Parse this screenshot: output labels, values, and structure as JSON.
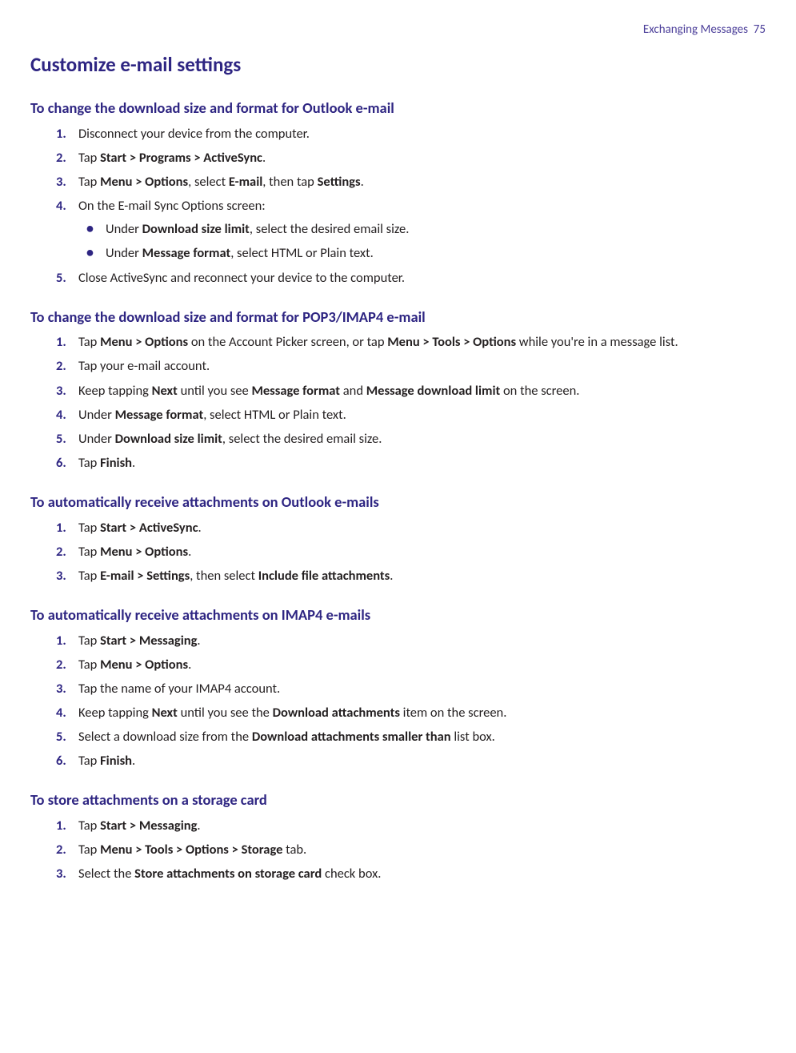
{
  "header": {
    "chapter": "Exchanging Messages",
    "page": "75"
  },
  "title": "Customize e-mail settings",
  "sections": [
    {
      "heading": "To change the download size and format for Outlook e-mail",
      "steps": [
        {
          "html": "Disconnect your device from the computer."
        },
        {
          "html": "Tap <b>Start > Programs > ActiveSync</b>."
        },
        {
          "html": "Tap <b>Menu > Options</b>, select <b>E-mail</b>, then tap <b>Settings</b>."
        },
        {
          "html": "On the E-mail Sync Options screen:",
          "bullets": [
            "Under <b>Download size limit</b>, select the desired email size.",
            "Under <b>Message format</b>, select HTML or Plain text."
          ]
        },
        {
          "html": "Close ActiveSync and reconnect your device to the computer."
        }
      ]
    },
    {
      "heading": "To change the download size and format for POP3/IMAP4 e-mail",
      "steps": [
        {
          "html": "Tap <b>Menu > Options</b> on the Account Picker screen, or tap <b>Menu > Tools > Options</b> while you're in a message list."
        },
        {
          "html": "Tap your e-mail account."
        },
        {
          "html": "Keep tapping <b>Next</b> until you see <b>Message format</b> and <b>Message download limit</b> on the screen."
        },
        {
          "html": "Under <b>Message format</b>, select HTML or Plain text."
        },
        {
          "html": "Under <b>Download size limit</b>, select the desired email size."
        },
        {
          "html": "Tap <b>Finish</b>."
        }
      ]
    },
    {
      "heading": "To automatically receive attachments on Outlook e-mails",
      "steps": [
        {
          "html": "Tap <b>Start > ActiveSync</b>."
        },
        {
          "html": "Tap <b>Menu > Options</b>."
        },
        {
          "html": "Tap <b>E-mail > Settings</b>, then select <b>Include file attachments</b>."
        }
      ]
    },
    {
      "heading": "To automatically receive attachments on IMAP4 e-mails",
      "steps": [
        {
          "html": "Tap  <b>Start > Messaging</b>."
        },
        {
          "html": "Tap <b>Menu > Options</b>."
        },
        {
          "html": "Tap the name of your IMAP4 account."
        },
        {
          "html": "Keep tapping <b>Next</b> until you see the <b>Download attachments</b> item on the screen."
        },
        {
          "html": "Select a download size from the <b>Download attachments smaller than</b> list box."
        },
        {
          "html": "Tap <b>Finish</b>."
        }
      ]
    },
    {
      "heading": "To store attachments on a storage card",
      "steps": [
        {
          "html": "Tap  <b>Start > Messaging</b>."
        },
        {
          "html": "Tap <b>Menu > Tools > Options > Storage</b> tab."
        },
        {
          "html": "Select the <b>Store attachments on  storage card</b> check box."
        }
      ]
    }
  ]
}
